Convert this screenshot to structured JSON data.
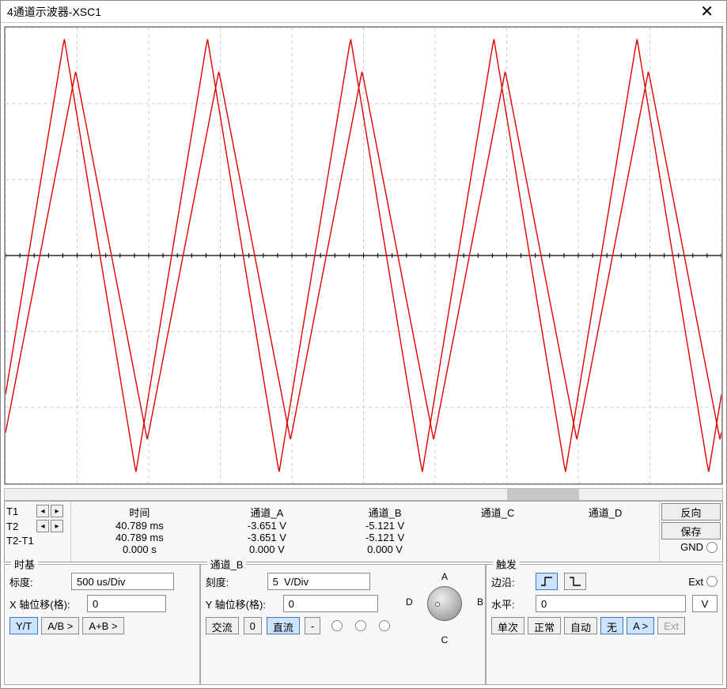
{
  "window": {
    "title": "4通道示波器-XSC1"
  },
  "chart_data": {
    "type": "line",
    "x_grid_divs": 10,
    "y_grid_divs": 6,
    "y_axis_position": 3,
    "timebase_per_div": "500 us",
    "vertical_per_div": "5 V",
    "series": [
      {
        "name": "通道_A",
        "waveform": "triangle",
        "period_divs": 2.0,
        "amplitude_divs": 2.43,
        "offset_divs": 0,
        "phase_divs": -0.02,
        "color": "#e00000"
      },
      {
        "name": "通道_B",
        "waveform": "triangle",
        "period_divs": 2.0,
        "amplitude_divs": 2.86,
        "offset_divs": 0,
        "phase_divs": -0.18,
        "color": "#e00000"
      }
    ]
  },
  "cursors": {
    "t1_label": "T1",
    "t2_label": "T2",
    "diff_label": "T2-T1"
  },
  "readout": {
    "headers": {
      "time": "时间",
      "chA": "通道_A",
      "chB": "通道_B",
      "chC": "通道_C",
      "chD": "通道_D"
    },
    "rows": [
      {
        "time": "40.789 ms",
        "chA": "-3.651 V",
        "chB": "-5.121 V",
        "chC": "",
        "chD": ""
      },
      {
        "time": "40.789 ms",
        "chA": "-3.651 V",
        "chB": "-5.121 V",
        "chC": "",
        "chD": ""
      },
      {
        "time": "0.000 s",
        "chA": "0.000 V",
        "chB": "0.000 V",
        "chC": "",
        "chD": ""
      }
    ]
  },
  "side": {
    "reverse": "反向",
    "save": "保存",
    "gnd": "GND"
  },
  "timebase": {
    "title": "时基",
    "scale_label": "标度:",
    "scale_value": "500 us/Div",
    "xpos_label": "X 轴位移(格):",
    "xpos_value": "0",
    "modes": {
      "yt": "Y/T",
      "ab_sweep": "A/B >",
      "ab_sum": "A+B >"
    }
  },
  "channel": {
    "title": "通道_B",
    "scale_label": "刻度:",
    "scale_value": "5  V/Div",
    "ypos_label": "Y 轴位移(格):",
    "ypos_value": "0",
    "coupling": {
      "ac": "交流",
      "zero": "0",
      "dc": "直流",
      "inv": "-"
    },
    "dial": {
      "A": "A",
      "B": "B",
      "C": "C",
      "D": "D"
    }
  },
  "trigger": {
    "title": "触发",
    "edge_label": "边沿:",
    "level_label": "水平:",
    "level_value": "0",
    "level_unit": "V",
    "ext_label": "Ext",
    "modes": {
      "single": "单次",
      "normal": "正常",
      "auto": "自动",
      "none": "无",
      "asrc": "A >",
      "ext": "Ext"
    }
  }
}
